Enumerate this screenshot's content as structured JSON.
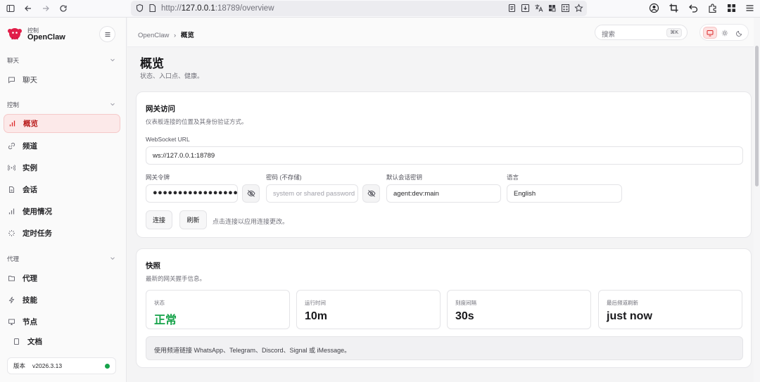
{
  "browser": {
    "url_prefix": "http://",
    "url_host": "127.0.0.1",
    "url_rest": ":18789/overview"
  },
  "sidebar": {
    "brand_sub": "控制",
    "brand": "OpenClaw",
    "sections": [
      {
        "label": "聊天"
      },
      {
        "label": "控制"
      },
      {
        "label": "代理"
      }
    ],
    "items": [
      {
        "label": "聊天",
        "icon": "chat-icon"
      },
      {
        "label": "概览",
        "icon": "bar-chart-icon"
      },
      {
        "label": "频道",
        "icon": "link-icon"
      },
      {
        "label": "实例",
        "icon": "broadcast-icon"
      },
      {
        "label": "会话",
        "icon": "document-icon"
      },
      {
        "label": "使用情况",
        "icon": "bar-chart-icon"
      },
      {
        "label": "定时任务",
        "icon": "loader-icon"
      },
      {
        "label": "代理",
        "icon": "folder-icon"
      },
      {
        "label": "技能",
        "icon": "zap-icon"
      },
      {
        "label": "节点",
        "icon": "monitor-icon"
      },
      {
        "label": "文档",
        "icon": "book-icon"
      }
    ],
    "version_label": "版本",
    "version": "v2026.3.13",
    "status_color": "#16a34a"
  },
  "topbar": {
    "breadcrumb_root": "OpenClaw",
    "breadcrumb_sep": "›",
    "breadcrumb_current": "概览",
    "search_placeholder": "搜索",
    "search_shortcut": "⌘K"
  },
  "page": {
    "title": "概览",
    "subtitle": "状态、入口点、健康。"
  },
  "gateway": {
    "title": "网关访问",
    "subtitle": "仪表板连接的位置及其身份验证方式。",
    "ws_label": "WebSocket URL",
    "ws_value": "ws://127.0.0.1:18789",
    "token_label": "网关令牌",
    "token_value": "●●●●●●●●●●●●●●●●●●●●",
    "password_label": "密码 (不存储)",
    "password_placeholder": "system or shared password",
    "session_label": "默认会话密钥",
    "session_value": "agent:dev:main",
    "lang_label": "语言",
    "lang_value": "English",
    "connect": "连接",
    "refresh": "刷新",
    "hint": "点击连接以应用连接更改。"
  },
  "snapshot": {
    "title": "快照",
    "subtitle": "最新的网关握手信息。",
    "stats": [
      {
        "label": "状态",
        "value": "正常"
      },
      {
        "label": "运行时间",
        "value": "10m"
      },
      {
        "label": "刻度间隔",
        "value": "30s"
      },
      {
        "label": "最后频道刷新",
        "value": "just now"
      }
    ],
    "note": "使用频道链接 WhatsApp、Telegram、Discord、Signal 或 iMessage。"
  },
  "colors": {
    "accent": "#dc2626",
    "accent_bg": "#fce9e9",
    "ok": "#16a34a"
  }
}
